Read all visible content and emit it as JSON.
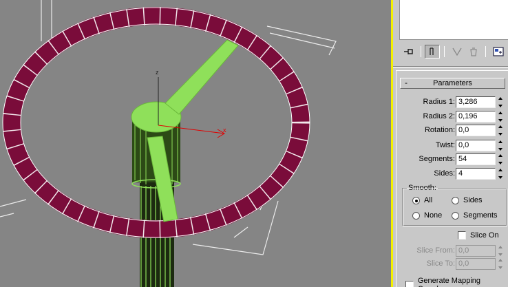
{
  "viewport": {
    "axis_x_label": "x",
    "axis_z_label": "z"
  },
  "toolbar": {
    "pin_icon": "pin-stack-icon",
    "show_end_result_icon": "show-end-result-icon",
    "make_unique_icon": "make-unique-icon",
    "remove_modifier_icon": "remove-modifier-icon",
    "configure_sets_icon": "configure-modifier-sets-icon"
  },
  "parameters": {
    "header": "Parameters",
    "collapse_symbol": "-",
    "rows": [
      {
        "label": "Radius 1:",
        "value": "3,286"
      },
      {
        "label": "Radius 2:",
        "value": "0,196"
      },
      {
        "label": "Rotation:",
        "value": "0,0"
      },
      {
        "label": "Twist:",
        "value": "0,0"
      },
      {
        "label": "Segments:",
        "value": "54"
      },
      {
        "label": "Sides:",
        "value": "4"
      }
    ]
  },
  "smooth": {
    "title": "Smooth:",
    "options": [
      {
        "label": "All",
        "selected": true
      },
      {
        "label": "Sides",
        "selected": false
      },
      {
        "label": "None",
        "selected": false
      },
      {
        "label": "Segments",
        "selected": false
      }
    ]
  },
  "slice": {
    "slice_on_label": "Slice On",
    "slice_from_label": "Slice From:",
    "slice_from_value": "0,0",
    "slice_to_label": "Slice To:",
    "slice_to_value": "0,0"
  },
  "generate_mapping_label": "Generate Mapping Coords.",
  "colors": {
    "viewport_bg": "#858585",
    "active_border": "#f4f000",
    "torus_fill": "#7a0c3a",
    "selected_green": "#8fe05a",
    "axis_red": "#e00000"
  }
}
